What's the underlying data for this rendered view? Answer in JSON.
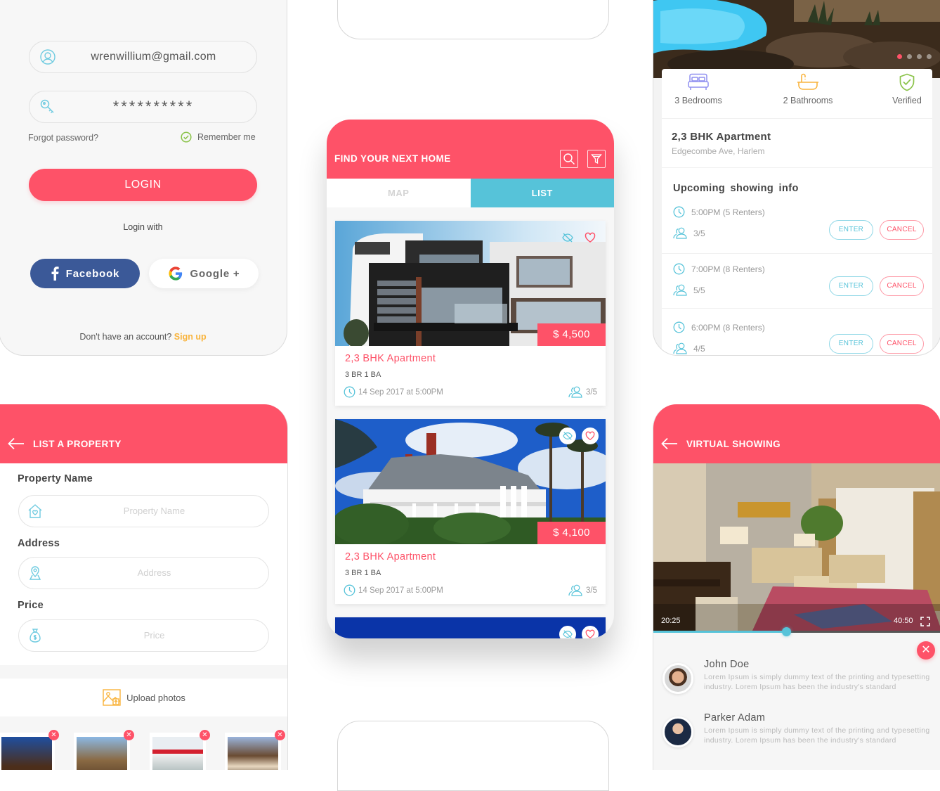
{
  "colors": {
    "accent": "#fe5268",
    "teal": "#56c3d9",
    "facebook": "#3b5998",
    "signup_link": "#f9b43d",
    "verified_green": "#8bc34a",
    "bed_purple": "#8f8ff0",
    "bath_orange": "#f9b43d"
  },
  "login": {
    "email_value": "wrenwillium@gmail.com",
    "password_value": "**********",
    "forgot_label": "Forgot password?",
    "remember_label": "Remember me",
    "remember_checked": true,
    "login_button": "LOGIN",
    "login_with_label": "Login with",
    "facebook_button": "Facebook",
    "google_button": "Google +",
    "signup_prompt": "Don't have an account?",
    "signup_link": "Sign up",
    "icons": {
      "email": "user-circle-icon",
      "password": "key-icon",
      "remember": "check-circle-icon",
      "facebook": "facebook-icon",
      "google": "google-icon"
    }
  },
  "listing": {
    "header_title": "FIND YOUR NEXT HOME",
    "header_icons": [
      "search-icon",
      "filter-icon"
    ],
    "tabs": [
      {
        "label": "MAP",
        "active": false
      },
      {
        "label": "LIST",
        "active": true
      }
    ],
    "cards": [
      {
        "price": "$ 4,500",
        "title": "2,3 BHK Apartment",
        "spec": "3 BR 1 BA",
        "date": "14 Sep 2017 at 5:00PM",
        "renters": "3/5",
        "photo": "modern-house"
      },
      {
        "price": "$ 4,100",
        "title": "2,3 BHK Apartment",
        "spec": "3 BR 1 BA",
        "date": "14 Sep 2017 at 5:00PM",
        "renters": "3/5",
        "photo": "victorian-house"
      }
    ]
  },
  "details": {
    "carousel": {
      "count": 4,
      "active_index": 0
    },
    "amenities": [
      {
        "label": "3 Bedrooms",
        "icon": "bed-icon"
      },
      {
        "label": "2 Bathrooms",
        "icon": "bathtub-icon"
      },
      {
        "label": "Verified",
        "icon": "shield-check-icon"
      }
    ],
    "title": "2,3 BHK Apartment",
    "address": "Edgecombe Ave, Harlem",
    "upcoming_title": "Upcoming  showing info",
    "enter_label": "ENTER",
    "cancel_label": "CANCEL",
    "slots": [
      {
        "time": "5:00PM (5 Renters)",
        "count": "3/5"
      },
      {
        "time": "7:00PM (8 Renters)",
        "count": "5/5"
      },
      {
        "time": "6:00PM (8 Renters)",
        "count": "4/5"
      }
    ]
  },
  "list_property": {
    "header_title": "LIST A PROPERTY",
    "fields": [
      {
        "label": "Property Name",
        "placeholder": "Property Name",
        "value": "",
        "icon": "house-heart-icon"
      },
      {
        "label": "Address",
        "placeholder": "Address",
        "value": "",
        "icon": "map-pin-icon"
      },
      {
        "label": "Price",
        "placeholder": "Price",
        "value": "",
        "icon": "money-bag-icon"
      }
    ],
    "upload_label": "Upload photos",
    "thumbnails": [
      "house-photo-1",
      "house-photo-2",
      "house-photo-3",
      "house-photo-4"
    ]
  },
  "virtual_showing": {
    "header_title": "VIRTUAL SHOWING",
    "time_current": "20:25",
    "time_total": "40:50",
    "progress_fraction": 0.46,
    "viewers": [
      {
        "name": "John Doe",
        "text": "Lorem Ipsum is simply dummy text of the printing and typesetting industry. Lorem Ipsum has been the industry's standard"
      },
      {
        "name": "Parker Adam",
        "text": "Lorem Ipsum is simply dummy text of the printing and typesetting industry. Lorem Ipsum has been the industry's standard"
      }
    ]
  }
}
